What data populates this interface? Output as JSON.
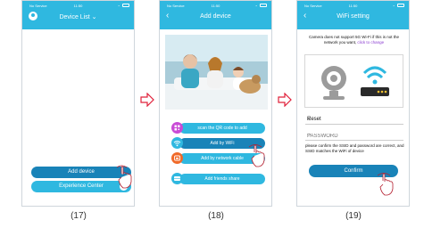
{
  "status_bar": {
    "carrier": "No Service",
    "time": "11:50"
  },
  "screen17": {
    "title": "Device List",
    "add_device": "Add device",
    "experience_center": "Experience Center"
  },
  "screen18": {
    "title": "Add device",
    "options": [
      {
        "label": "scan the QR code to add",
        "icon": "qr-icon",
        "color": "#c94bd6"
      },
      {
        "label": "Add by WiFi",
        "icon": "wifi-icon",
        "color": "#2fb8e0"
      },
      {
        "label": "Add by network cable",
        "icon": "network-cable-icon",
        "color": "#f06a2a"
      },
      {
        "label": "Add friends share",
        "icon": "friends-share-icon",
        "color": "#2fb8e0"
      }
    ]
  },
  "screen19": {
    "title": "WiFi setting",
    "notice": "Camera does not support 5G Wi-Fi if this is not the network you want,",
    "notice_link": "click to change",
    "wifi_name": "Reset",
    "password_placeholder": "PASSWORD",
    "hint": "please confirm the SSID and password are correct, and SSID matches the WiFi of device",
    "confirm": "Confirm"
  },
  "captions": [
    "(17)",
    "(18)",
    "(19)"
  ],
  "colors": {
    "accent": "#2fb8e0",
    "accent_dark": "#1983b8",
    "arrow": "#e0203a"
  }
}
